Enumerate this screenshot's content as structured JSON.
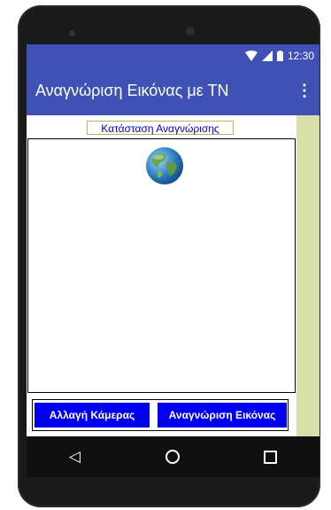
{
  "status_bar": {
    "time": "12:30",
    "icons": [
      "wifi-icon",
      "signal-icon",
      "battery-icon"
    ]
  },
  "app_bar": {
    "title": "Αναγνώριση Εικόνας με ΤΝ",
    "menu_icon": "overflow-menu-icon"
  },
  "content": {
    "status_label": "Κατάσταση Αναγνώρισης",
    "image_icon": "globe-icon"
  },
  "buttons": {
    "switch_camera": "Αλλαγή Κάμερας",
    "recognize_image": "Αναγνώριση Εικόνας"
  },
  "nav_bar": {
    "icons": [
      "back-icon",
      "home-icon",
      "recents-icon"
    ]
  },
  "colors": {
    "primary": "#3f51b5",
    "button": "#0000ee",
    "label_text": "#0000cc",
    "side_strip": "#d7e0a8"
  }
}
